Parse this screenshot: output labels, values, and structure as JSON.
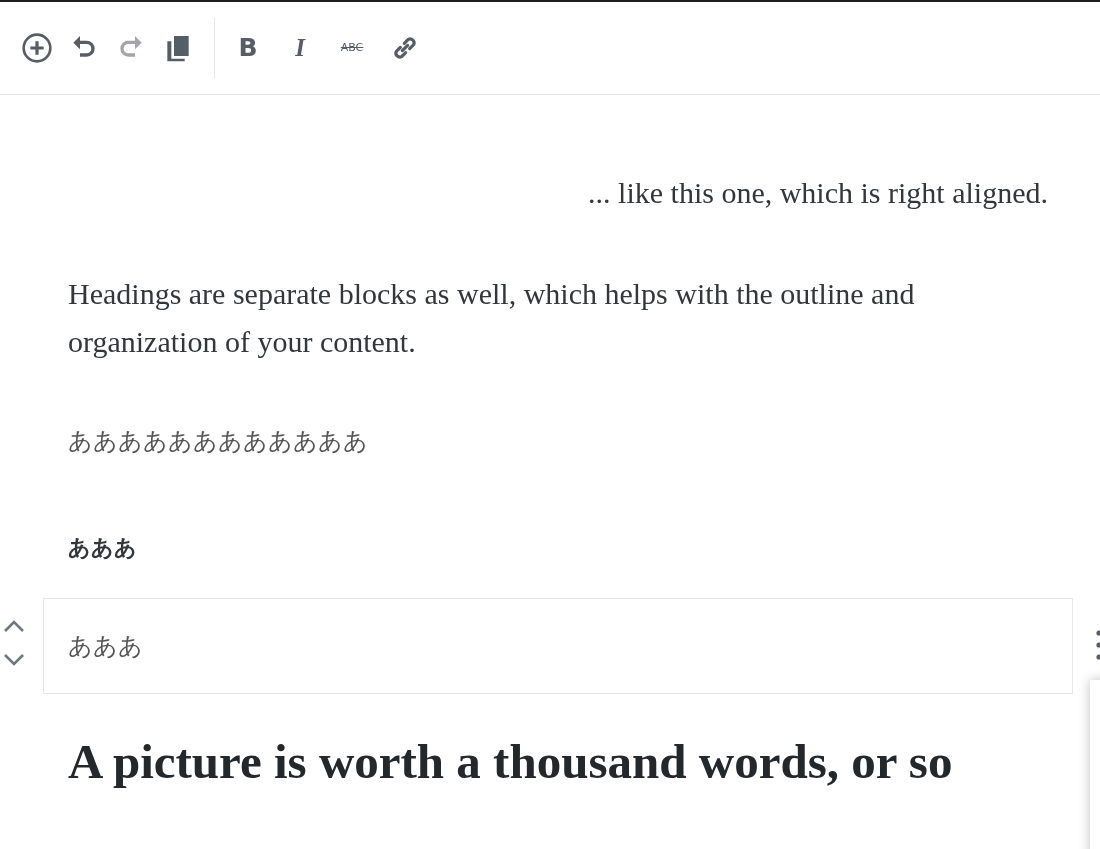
{
  "toolbar": {
    "history": [
      {
        "kind": "inserter",
        "disabled": false
      },
      {
        "kind": "undo",
        "disabled": false
      },
      {
        "kind": "redo",
        "disabled": true
      },
      {
        "kind": "copy",
        "disabled": false
      }
    ],
    "format": [
      {
        "kind": "bold",
        "label": "B"
      },
      {
        "kind": "italic",
        "label": "I"
      },
      {
        "kind": "strikethrough",
        "label": "ABC"
      },
      {
        "kind": "link"
      }
    ]
  },
  "blocks": [
    {
      "kind": "paragraph",
      "text": "... like this one, which is right aligned.",
      "right_aligned": true,
      "selected": false
    },
    {
      "kind": "paragraph",
      "text": "Headings are separate blocks as well, which helps with the outline and organization of your content.",
      "right_aligned": false,
      "selected": false
    },
    {
      "kind": "cjk",
      "text": "ああああああああああああ",
      "right_aligned": false,
      "selected": false
    },
    {
      "kind": "cjk-heading",
      "text": "あああ",
      "right_aligned": false,
      "selected": false
    },
    {
      "kind": "cjk",
      "text": "あああ",
      "right_aligned": false,
      "selected": true
    },
    {
      "kind": "heading",
      "text": "A picture is worth a thousand words, or so",
      "right_aligned": false,
      "selected": false
    }
  ]
}
